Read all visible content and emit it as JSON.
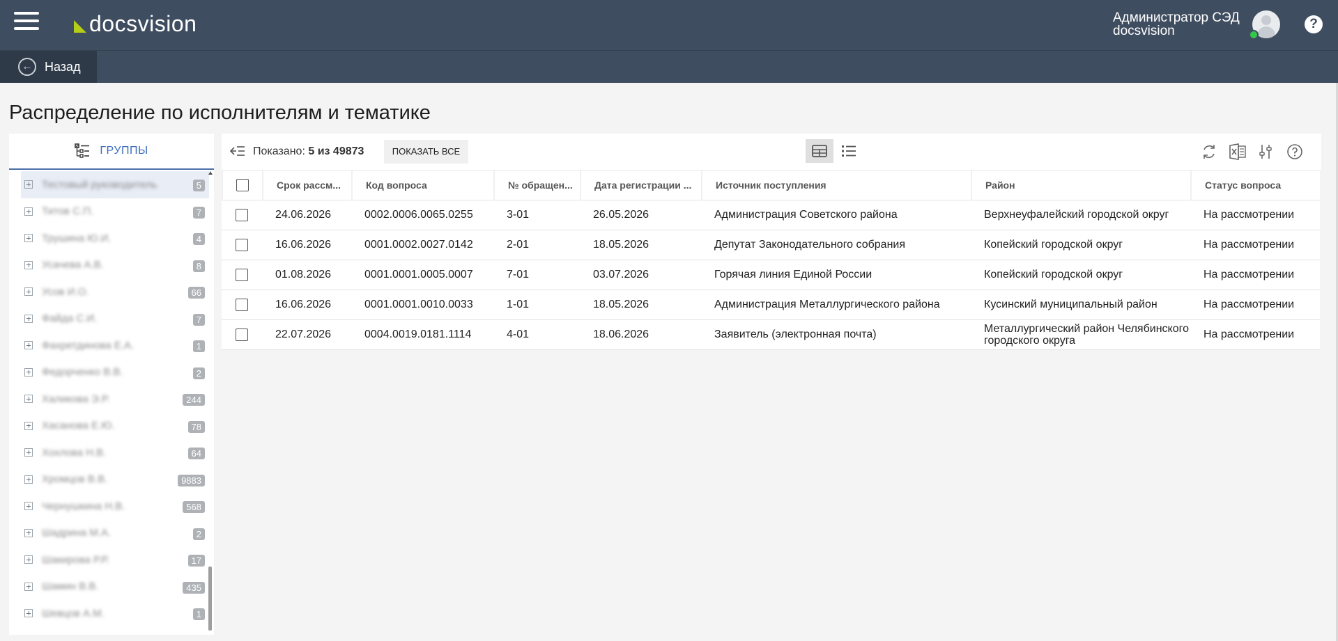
{
  "header": {
    "logo_text": "docsvision",
    "user_name": "Администратор СЭД",
    "user_org": "docsvision"
  },
  "subbar": {
    "back_label": "Назад"
  },
  "page": {
    "title": "Распределение по исполнителям и тематике"
  },
  "sidebar": {
    "tab_label": "ГРУППЫ",
    "items": [
      {
        "name": "Тестовый руководитель",
        "count": "5"
      },
      {
        "name": "Титов С.П.",
        "count": "7"
      },
      {
        "name": "Трушина Ю.И.",
        "count": "4"
      },
      {
        "name": "Усачева А.В.",
        "count": "8"
      },
      {
        "name": "Усов И.О.",
        "count": "66"
      },
      {
        "name": "Файда С.И.",
        "count": "7"
      },
      {
        "name": "Фахретдинова Е.А.",
        "count": "1"
      },
      {
        "name": "Федорченко В.В.",
        "count": "2"
      },
      {
        "name": "Халикова Э.Р.",
        "count": "244"
      },
      {
        "name": "Хасанова Е.Ю.",
        "count": "78"
      },
      {
        "name": "Хохлова Н.В.",
        "count": "64"
      },
      {
        "name": "Хромцов В.В.",
        "count": "9883"
      },
      {
        "name": "Чернушкина Н.В.",
        "count": "568"
      },
      {
        "name": "Шадрина М.А.",
        "count": "2"
      },
      {
        "name": "Шакирова Р.Р.",
        "count": "17"
      },
      {
        "name": "Шамин В.В.",
        "count": "435"
      },
      {
        "name": "Шевцов А.М.",
        "count": "1"
      }
    ]
  },
  "toolbar": {
    "shown_label": "Показано:",
    "shown_value": "5 из 49873",
    "show_all_label": "ПОКАЗАТЬ ВСЕ"
  },
  "table": {
    "columns": [
      "Срок рассм...",
      "Код вопроса",
      "№ обращен...",
      "Дата регистрации ...",
      "Источник поступления",
      "Район",
      "Статус вопроса"
    ],
    "rows": [
      [
        "24.06.2026",
        "0002.0006.0065.0255",
        "3-01",
        "26.05.2026",
        "Администрация Советского района",
        "Верхнеуфалейский городской округ",
        "На рассмотрении"
      ],
      [
        "16.06.2026",
        "0001.0002.0027.0142",
        "2-01",
        "18.05.2026",
        "Депутат Законодательного собрания",
        "Копейский городской округ",
        "На рассмотрении"
      ],
      [
        "01.08.2026",
        "0001.0001.0005.0007",
        "7-01",
        "03.07.2026",
        "Горячая линия Единой России",
        "Копейский городской округ",
        "На рассмотрении"
      ],
      [
        "16.06.2026",
        "0001.0001.0010.0033",
        "1-01",
        "18.05.2026",
        "Администрация Металлургического района",
        "Кусинский муниципальный район",
        "На рассмотрении"
      ],
      [
        "22.07.2026",
        "0004.0019.0181.1114",
        "4-01",
        "18.06.2026",
        "Заявитель (электронная почта)",
        "Металлургический район Челябинского городского округа",
        "На рассмотрении"
      ]
    ]
  },
  "colors": {
    "header_bg": "#3f4d60",
    "accent": "#3d6dbd",
    "logo_accent": "#b5cc18",
    "online": "#34c84a"
  }
}
